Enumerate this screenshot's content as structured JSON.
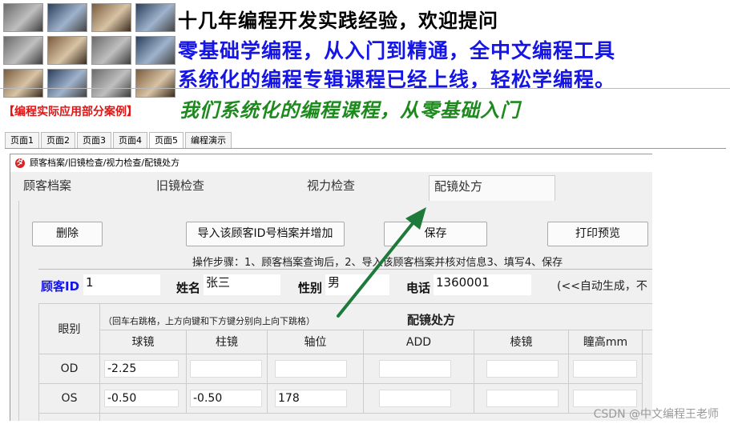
{
  "banner": {
    "line1": "十几年编程开发实践经验，欢迎提问",
    "line2": "零基础学编程，从入门到精通，全中文编程工具",
    "line3": "系统化的编程专辑课程已经上线，轻松学编程。",
    "red_label": "【编程实际应用部分案例】",
    "green_slogan": "我们系统化的编程课程，从零基础入门"
  },
  "page_tabs": [
    "页面1",
    "页面2",
    "页面3",
    "页面4",
    "页面5",
    "编程演示"
  ],
  "window": {
    "title": "顾客档案/旧镜检查/视力检查/配镜处方",
    "tabs": [
      "顾客档案",
      "旧镜检查",
      "视力检查",
      "配镜处方"
    ]
  },
  "buttons": {
    "delete": "删除",
    "import": "导入该顾客ID号档案并增加",
    "save": "保存",
    "print_preview": "打印预览"
  },
  "steps": "操作步骤：1、顾客档案查询后，2、导入该顾客档案并核对信息3、填写4、保存",
  "customer": {
    "id_label": "顾客ID",
    "id_value": "1",
    "name_label": "姓名",
    "name_value": "张三",
    "gender_label": "性别",
    "gender_value": "男",
    "phone_label": "电话",
    "phone_value": "1360001",
    "note": "(<<自动生成，不"
  },
  "prescription": {
    "eye_header": "眼别",
    "hint": "（回车右跳格，上方向键和下方键分别向上向下跳格）",
    "title": "配镜处方",
    "columns": [
      "球镜",
      "柱镜",
      "轴位",
      "ADD",
      "棱镜",
      "瞳高mm"
    ],
    "rows": [
      {
        "eye": "OD",
        "values": [
          "-2.25",
          "",
          "",
          "",
          "",
          ""
        ]
      },
      {
        "eye": "OS",
        "values": [
          "-0.50",
          "-0.50",
          "178",
          "",
          "",
          ""
        ]
      }
    ]
  },
  "watermark": "CSDN @中文编程王老师",
  "colors": {
    "blue_text": "#1515e6",
    "red_text": "#e01414",
    "green_text": "#1e8a1e",
    "arrow": "#1e7a3a"
  }
}
